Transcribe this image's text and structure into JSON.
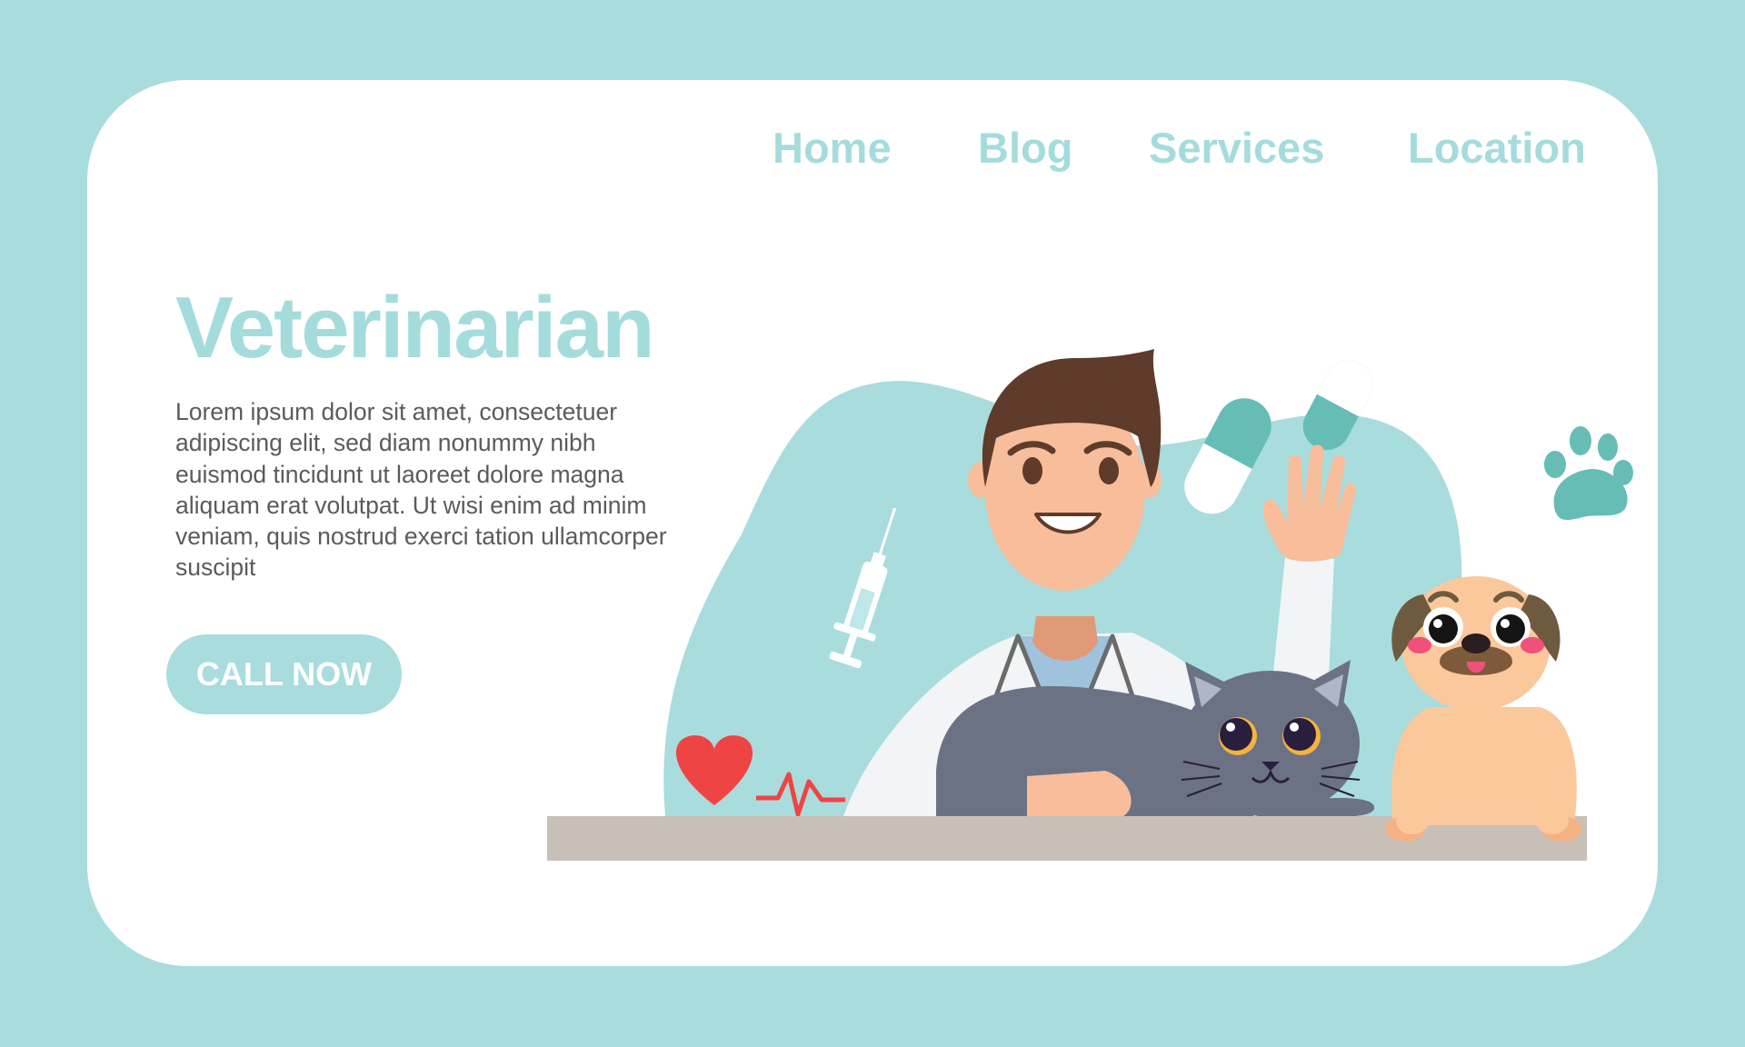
{
  "nav": {
    "items": [
      {
        "label": "Home"
      },
      {
        "label": "Blog"
      },
      {
        "label": "Services"
      },
      {
        "label": "Location"
      }
    ]
  },
  "hero": {
    "title": "Veterinarian",
    "body": "Lorem ipsum dolor sit amet, consectetuer adipiscing elit, sed diam nonummy nibh euismod tincidunt ut laoreet dolore magna aliquam erat volutpat. Ut wisi enim ad minim veniam, quis nostrud exerci tation ullamcorper suscipit",
    "cta_label": "CALL NOW"
  },
  "illustration": {
    "icons": [
      "heartbeat-icon",
      "syringe-icon",
      "capsule-icon",
      "paw-print-icon"
    ],
    "figures": [
      "veterinarian",
      "gray-cat",
      "pug-dog"
    ]
  },
  "colors": {
    "background": "#a9dcdc",
    "card": "#ffffff",
    "accent": "#a4dcdc",
    "body_text": "#5b5b5b",
    "blob": "#a9dcdc",
    "table": "#c8bfb6"
  }
}
